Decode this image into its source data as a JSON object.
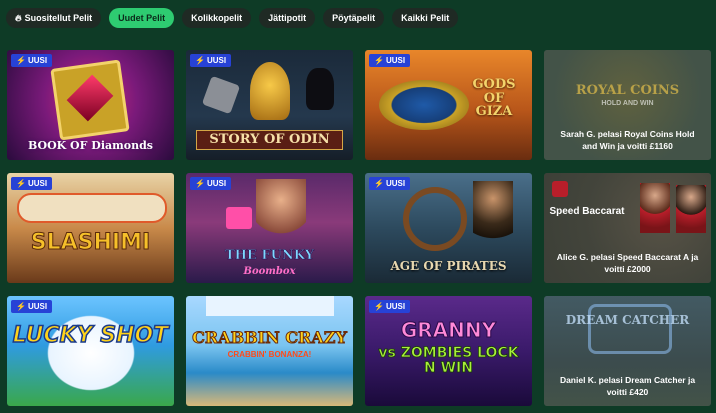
{
  "tabs": [
    {
      "label": "Suositellut Pelit",
      "icon": "flame-icon"
    },
    {
      "label": "Uudet Pelit"
    },
    {
      "label": "Kolikkopelit"
    },
    {
      "label": "Jättipotit"
    },
    {
      "label": "Pöytäpelit"
    },
    {
      "label": "Kaikki Pelit"
    }
  ],
  "active_tab": "Uudet Pelit",
  "badge_label": "UUSI",
  "games": [
    {
      "title": "BOOK OF Diamonds",
      "new": true
    },
    {
      "title": "STORY OF ODIN",
      "new": true
    },
    {
      "title": "GODS OF GIZA",
      "new": true
    },
    {
      "title": "ROYAL COINS",
      "subtitle": "HOLD AND WIN",
      "caption": "Sarah G. pelasi Royal Coins Hold and Win ja voitti £1160"
    },
    {
      "title": "SLASHIMI",
      "new": true
    },
    {
      "title": "THE FUNKY",
      "subtitle": "Boombox",
      "new": true
    },
    {
      "title": "AGE OF PIRATES",
      "new": true
    },
    {
      "title": "Speed Baccarat",
      "caption": "Alice G. pelasi Speed Baccarat A ja voitti £2000"
    },
    {
      "title": "LUCKY SHOT",
      "new": true
    },
    {
      "title": "CRABBIN CRAZY",
      "subtitle": "CRABBIN' BONANZA!",
      "new": true
    },
    {
      "title": "GRANNY",
      "subtitle": "vs ZOMBIES LOCK N WIN",
      "new": true
    },
    {
      "title": "DREAM CATCHER",
      "caption": "Daniel K. pelasi Dream Catcher ja voitti £420"
    }
  ],
  "colors": {
    "background": "#0e3b26",
    "tab_bg": "#1f2a24",
    "tab_active": "#2ecc71",
    "badge": "#2742d6"
  }
}
